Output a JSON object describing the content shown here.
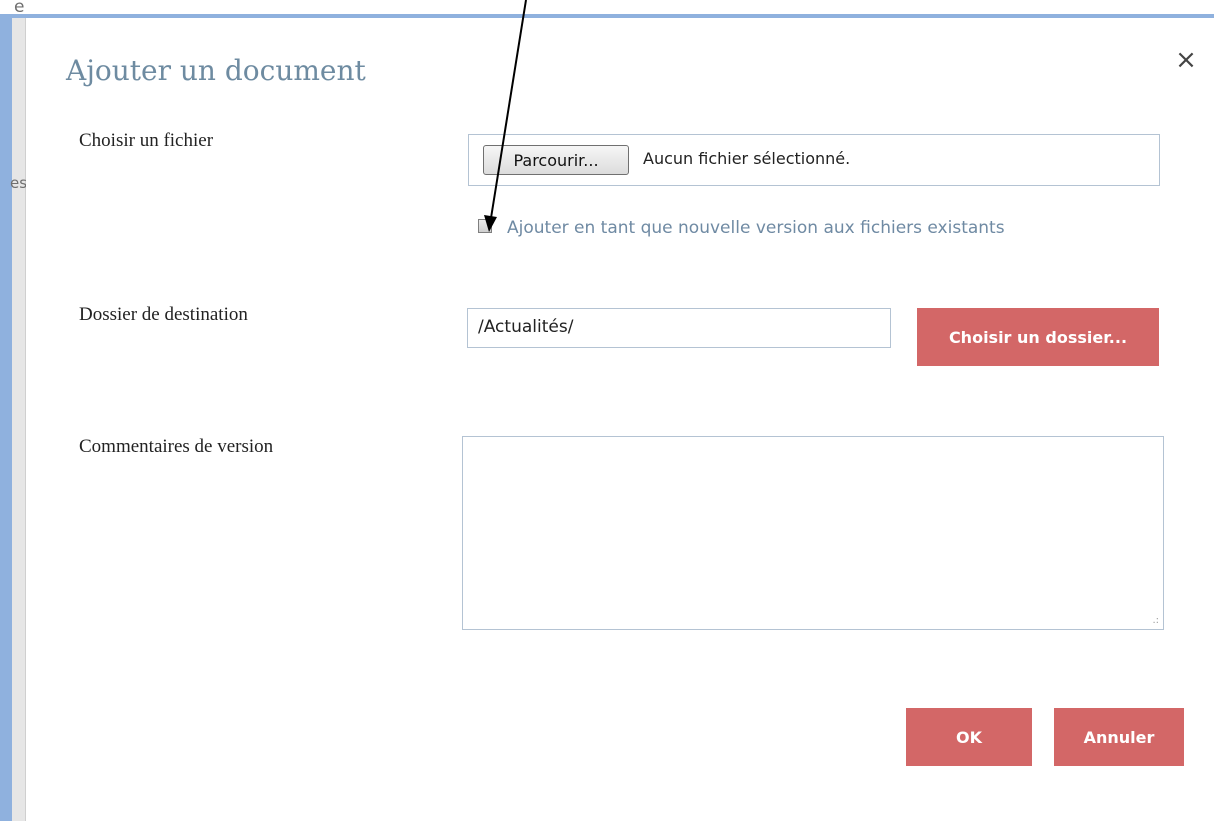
{
  "background": {
    "fragment_top": "e",
    "fragment_left": "es"
  },
  "dialog": {
    "title": "Ajouter un document",
    "close_icon": "×",
    "choose_file": {
      "label": "Choisir un fichier",
      "browse_button": "Parcourir...",
      "status": "Aucun fichier sélectionné."
    },
    "new_version_checkbox": {
      "label": "Ajouter en tant que nouvelle version aux fichiers existants",
      "checked": false
    },
    "destination": {
      "label": "Dossier de destination",
      "value": "/Actualités/",
      "choose_button": "Choisir un dossier..."
    },
    "comments": {
      "label": "Commentaires de version",
      "value": ""
    },
    "ok_button": "OK",
    "cancel_button": "Annuler"
  },
  "colors": {
    "accent_button": "#d36767",
    "title": "#6e8ba1",
    "frame": "#8fb1de"
  }
}
